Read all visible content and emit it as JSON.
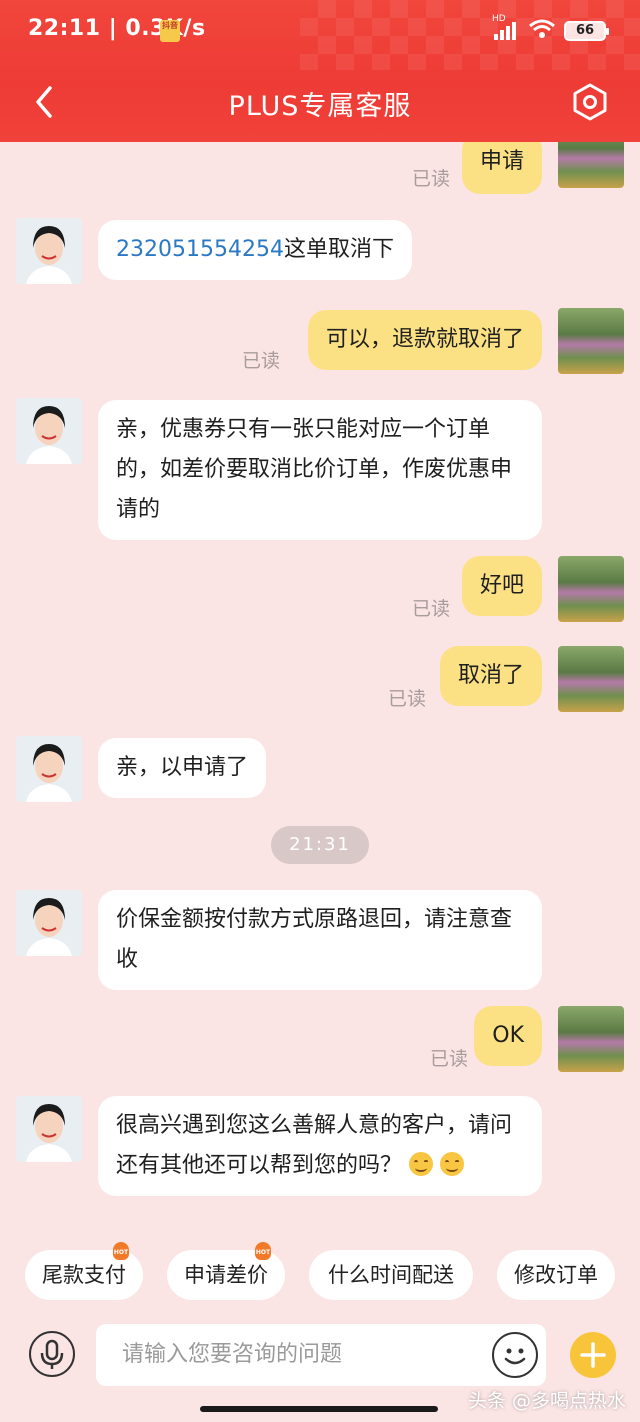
{
  "status": {
    "time": "22:11 | 0.3K/s",
    "badge": "抖音",
    "network": "HD",
    "battery": "66"
  },
  "nav": {
    "title": "PLUS专属客服"
  },
  "messages": {
    "m0": {
      "text": "申请",
      "read": "已读"
    },
    "m1": {
      "link": "232051554254",
      "text": "这单取消下"
    },
    "m2": {
      "text": "可以，退款就取消了",
      "read": "已读"
    },
    "m3": {
      "text": "亲，优惠券只有一张只能对应一个订单的，如差价要取消比价订单，作废优惠申请的"
    },
    "m4": {
      "text": "好吧",
      "read": "已读"
    },
    "m5": {
      "text": "取消了",
      "read": "已读"
    },
    "m6": {
      "text": "亲，以申请了"
    },
    "time": "21:31",
    "m7": {
      "text": "价保金额按付款方式原路退回，请注意查收"
    },
    "m8": {
      "text": "OK",
      "read": "已读"
    },
    "m9": {
      "text": "很高兴遇到您这么善解人意的客户，请问还有其他还可以帮到您的吗？"
    }
  },
  "quick_replies": [
    {
      "label": "尾款支付",
      "hot": true
    },
    {
      "label": "申请差价",
      "hot": true
    },
    {
      "label": "什么时间配送",
      "hot": false
    },
    {
      "label": "修改订单",
      "hot": false
    }
  ],
  "input": {
    "placeholder": "请输入您要咨询的问题"
  },
  "watermark": "头条 @多喝点热水",
  "colors": {
    "header": "#ee3b35",
    "user_bubble": "#fbe183",
    "agent_bubble": "#ffffff",
    "background": "#fbe4e4",
    "link": "#2b78c5",
    "plus_button": "#f8c53a"
  }
}
